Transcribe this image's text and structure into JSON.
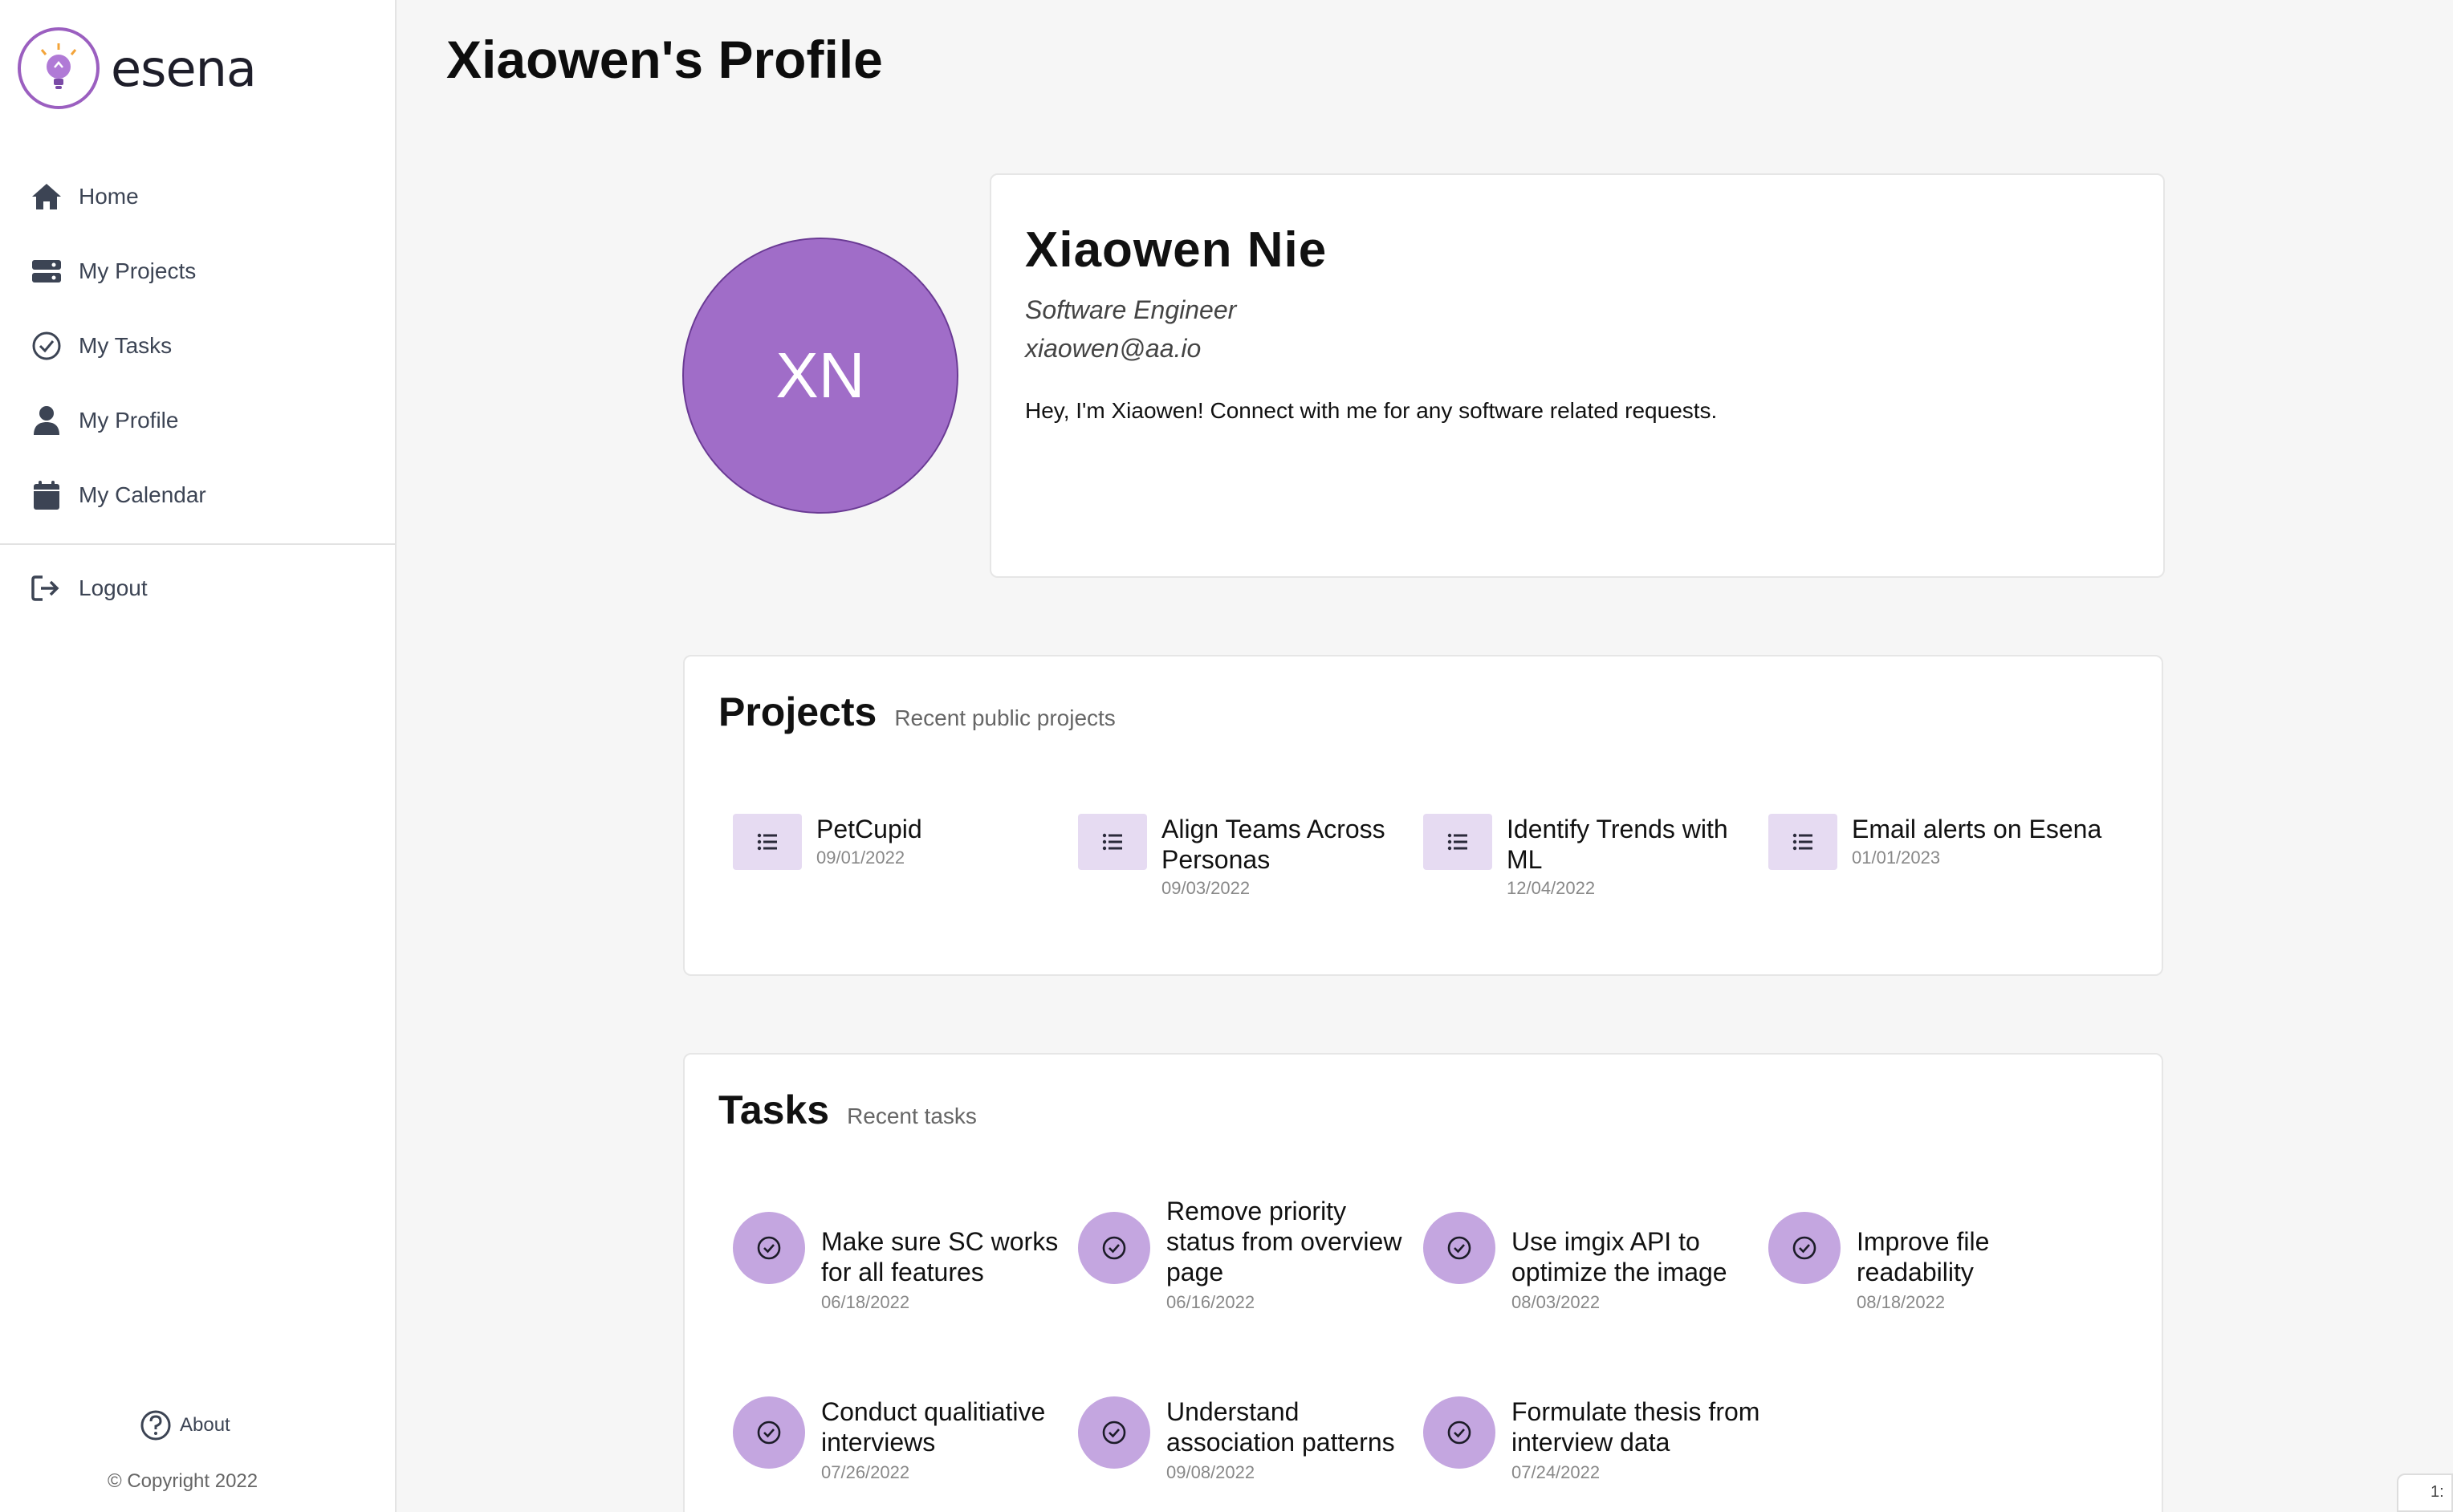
{
  "brand": {
    "name": "esena",
    "accent": "#a06dc8",
    "accent_light": "#c4a6e0",
    "icon_bg": "#e6dbf2"
  },
  "sidebar": {
    "items": [
      {
        "label": "Home",
        "icon": "home-icon"
      },
      {
        "label": "My Projects",
        "icon": "projects-icon"
      },
      {
        "label": "My Tasks",
        "icon": "check-circle-icon"
      },
      {
        "label": "My Profile",
        "icon": "user-icon"
      },
      {
        "label": "My Calendar",
        "icon": "calendar-icon"
      }
    ],
    "logout": "Logout",
    "about": "About",
    "copyright": "© Copyright 2022"
  },
  "page": {
    "title": "Xiaowen's Profile"
  },
  "profile": {
    "initials": "XN",
    "name": "Xiaowen Nie",
    "role": "Software Engineer",
    "email": "xiaowen@aa.io",
    "bio": "Hey, I'm Xiaowen! Connect with me for any software related requests."
  },
  "projects": {
    "title": "Projects",
    "subtitle": "Recent public projects",
    "items": [
      {
        "name": "PetCupid",
        "date": "09/01/2022"
      },
      {
        "name": "Align Teams Across Personas",
        "date": "09/03/2022"
      },
      {
        "name": "Identify Trends with ML",
        "date": "12/04/2022"
      },
      {
        "name": "Email alerts on Esena",
        "date": "01/01/2023"
      }
    ]
  },
  "tasks": {
    "title": "Tasks",
    "subtitle": "Recent tasks",
    "items": [
      {
        "name": "Make sure SC works for all features",
        "date": "06/18/2022"
      },
      {
        "name": "Remove priority status from overview page",
        "date": "06/16/2022"
      },
      {
        "name": "Use imgix API to optimize the image",
        "date": "08/03/2022"
      },
      {
        "name": "Improve file readability",
        "date": "08/18/2022"
      },
      {
        "name": "Conduct qualitiative interviews",
        "date": "07/26/2022"
      },
      {
        "name": "Understand association patterns",
        "date": "09/08/2022"
      },
      {
        "name": "Formulate thesis from interview data",
        "date": "07/24/2022"
      }
    ]
  },
  "corner_label": "1:"
}
